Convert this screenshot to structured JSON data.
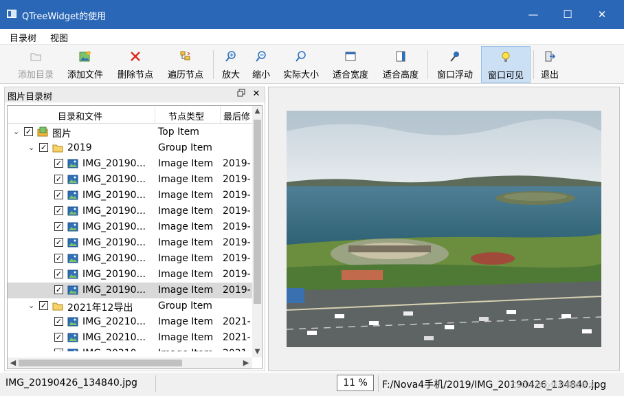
{
  "window": {
    "title": "QTreeWidget的使用",
    "minimize": "—",
    "maximize": "☐",
    "close": "✕"
  },
  "menu": [
    "目录树",
    "视图"
  ],
  "toolbar": {
    "add_dir": "添加目录",
    "add_file": "添加文件",
    "delete_node": "删除节点",
    "traverse": "遍历节点",
    "zoom_in": "放大",
    "zoom_out": "缩小",
    "actual_size": "实际大小",
    "fit_width": "适合宽度",
    "fit_height": "适合高度",
    "float_window": "窗口浮动",
    "window_visible": "窗口可见",
    "exit": "退出"
  },
  "dock": {
    "title": "图片目录树",
    "float_icon": "float-icon",
    "close_icon": "close-icon"
  },
  "tree": {
    "headers": [
      "目录和文件",
      "节点类型",
      "最后修"
    ],
    "rows": [
      {
        "name": "图片",
        "type": "Top Item",
        "date": "",
        "icon": "top-folder-icon",
        "arrow": "expanded",
        "checked": true
      },
      {
        "name": "2019",
        "type": "Group Item",
        "date": "",
        "icon": "folder-icon",
        "arrow": "expanded",
        "checked": true
      },
      {
        "name": "IMG_20190...",
        "type": "Image Item",
        "date": "2019-",
        "icon": "image-icon",
        "checked": true
      },
      {
        "name": "IMG_20190...",
        "type": "Image Item",
        "date": "2019-",
        "icon": "image-icon",
        "checked": true
      },
      {
        "name": "IMG_20190...",
        "type": "Image Item",
        "date": "2019-",
        "icon": "image-icon",
        "checked": true
      },
      {
        "name": "IMG_20190...",
        "type": "Image Item",
        "date": "2019-",
        "icon": "image-icon",
        "checked": true
      },
      {
        "name": "IMG_20190...",
        "type": "Image Item",
        "date": "2019-",
        "icon": "image-icon",
        "checked": true
      },
      {
        "name": "IMG_20190...",
        "type": "Image Item",
        "date": "2019-",
        "icon": "image-icon",
        "checked": true
      },
      {
        "name": "IMG_20190...",
        "type": "Image Item",
        "date": "2019-",
        "icon": "image-icon",
        "checked": true
      },
      {
        "name": "IMG_20190...",
        "type": "Image Item",
        "date": "2019-",
        "icon": "image-icon",
        "checked": true
      },
      {
        "name": "IMG_20190...",
        "type": "Image Item",
        "date": "2019-",
        "icon": "image-icon",
        "checked": true,
        "selected": true
      },
      {
        "name": "2021年12导出",
        "type": "Group Item",
        "date": "",
        "icon": "folder-icon",
        "arrow": "expanded",
        "checked": true
      },
      {
        "name": "IMG_20210...",
        "type": "Image Item",
        "date": "2021-",
        "icon": "image-icon",
        "checked": true
      },
      {
        "name": "IMG_20210...",
        "type": "Image Item",
        "date": "2021-",
        "icon": "image-icon",
        "checked": true
      },
      {
        "name": "IMG_20210...",
        "type": "Image Item",
        "date": "2021-",
        "icon": "image-icon",
        "checked": true
      }
    ]
  },
  "status": {
    "file": "IMG_20190426_134840.jpg",
    "zoom": "11 %",
    "path": "F:/Nova4手机/2019/IMG_20190426_134840.jpg",
    "watermark": "CSDN @心怀开将成怀太"
  },
  "colors": {
    "titlebar": "#2b67b7",
    "checked_button": "#cce0f5",
    "selected_row": "#d9d9d9"
  }
}
